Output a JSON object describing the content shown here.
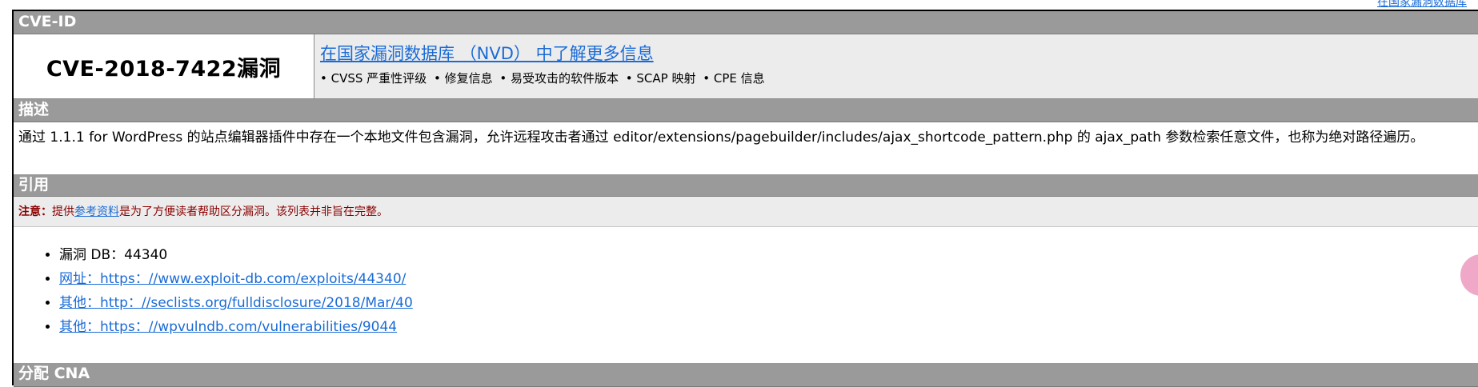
{
  "header": {
    "top_link": "在国家漏洞数据库"
  },
  "sections": {
    "cve_id_label": "CVE-ID",
    "description_label": "描述",
    "references_label": "引用",
    "cna_label": "分配 CNA"
  },
  "cve": {
    "title": "CVE-2018-7422漏洞",
    "nvd_link": "在国家漏洞数据库 （NVD） 中了解更多信息",
    "nvd_items": [
      "• CVSS 严重性评级",
      "• 修复信息",
      "• 易受攻击的软件版本",
      "• SCAP 映射",
      "• CPE 信息"
    ]
  },
  "description": {
    "text": "通过 1.1.1 for WordPress 的站点编辑器插件中存在一个本地文件包含漏洞，允许远程攻击者通过 editor/extensions/pagebuilder/includes/ajax_shortcode_pattern.php 的 ajax_path 参数检索任意文件，也称为绝对路径遍历。"
  },
  "note": {
    "prefix": "注意：",
    "before_link": "提供",
    "link_text": "参考资料",
    "after_link": "是为了方便读者帮助区分漏洞。该列表并非旨在完整。"
  },
  "references": [
    {
      "text": "漏洞 DB：44340",
      "is_link": false
    },
    {
      "text": "网址：https：//www.exploit-db.com/exploits/44340/",
      "is_link": true
    },
    {
      "text": "其他：http：//seclists.org/fulldisclosure/2018/Mar/40",
      "is_link": true
    },
    {
      "text": "其他：https：//wpvulndb.com/vulnerabilities/9044",
      "is_link": true
    }
  ],
  "colors": {
    "band_bg": "#9a9a9a",
    "link": "#1a6bd6",
    "note_text": "#8b0000",
    "panel_bg": "#ececec"
  }
}
